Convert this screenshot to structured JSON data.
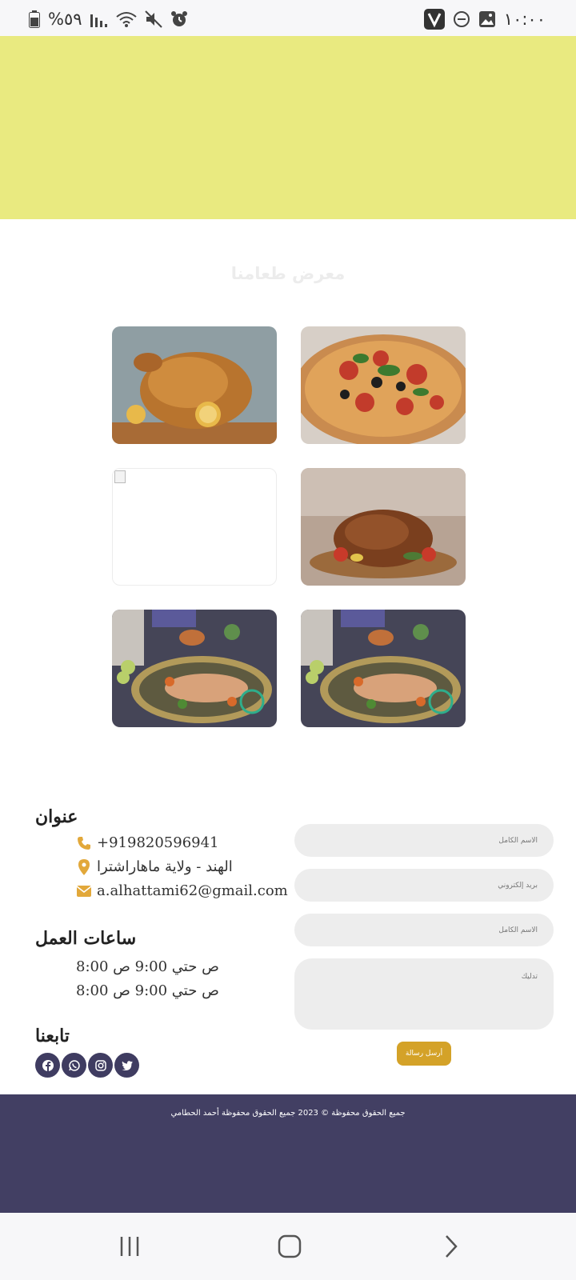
{
  "status_bar": {
    "time": "١٠:٠٠",
    "battery": "%٥٩",
    "icons": [
      "vpn-v-icon",
      "dnd-icon",
      "gallery-icon",
      "signal-icon",
      "wifi-icon",
      "mute-icon",
      "alarm-icon",
      "battery-icon"
    ]
  },
  "colors": {
    "hero": "#e9ea80",
    "accent": "#d4a228",
    "footer": "#423f63",
    "field": "#ededed"
  },
  "gallery": {
    "title": "معرض طعامنا",
    "images": [
      {
        "name": "pizza-image",
        "subject": "pizza"
      },
      {
        "name": "roast-chicken-lemon-image",
        "subject": "roast chicken with lemon"
      },
      {
        "name": "roast-chicken-board-image",
        "subject": "roast chicken on wooden board"
      },
      {
        "name": "broken-image",
        "subject": ""
      },
      {
        "name": "fish-platter-image-right",
        "subject": "fish platter"
      },
      {
        "name": "fish-platter-image-left",
        "subject": "fish platter"
      }
    ]
  },
  "contact": {
    "address_heading": "عنوان",
    "phone": "+919820596941",
    "location": "الهند - ولاية ماهاراشترا",
    "email": "a.alhattami62@gmail.com",
    "hours_heading": "ساعات العمل",
    "hours": [
      "8:00 ص حتي 9:00 ص",
      "8:00 ص حتي 9:00 ص"
    ],
    "follow_heading": "تابعنا",
    "social": [
      "facebook-icon",
      "whatsapp-icon",
      "instagram-icon",
      "twitter-icon"
    ]
  },
  "form": {
    "name_placeholder": "الاسم الكامل",
    "email_placeholder": "بريد إلكتروني",
    "subject_placeholder": "الاسم الكامل",
    "message_placeholder": "تدليك",
    "send_label": "أرسل رسالة"
  },
  "footer": {
    "text": "جميع الحقوق محفوظة © 2023 جميع الحقوق محفوظة أحمد الحطامي"
  }
}
